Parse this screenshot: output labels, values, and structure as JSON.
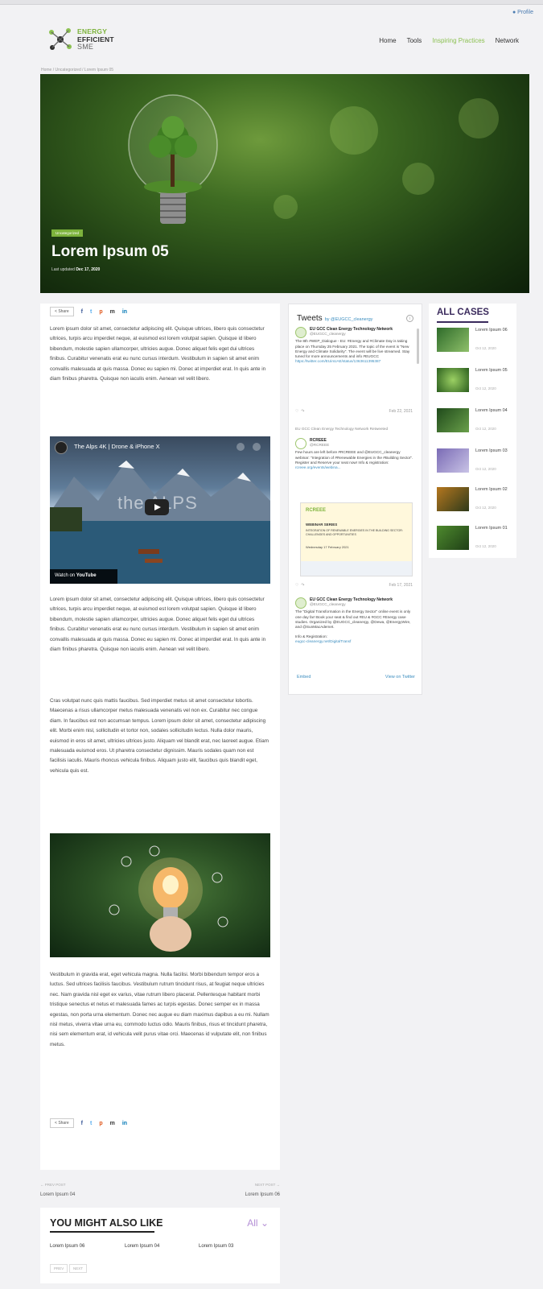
{
  "top": {
    "profile_label": "Profile"
  },
  "logo": {
    "line1": "ENERGY",
    "line2": "EFFICIENT",
    "line3": "SME"
  },
  "nav": {
    "items": [
      "Home",
      "Tools",
      "Inspiring Practices",
      "Network"
    ],
    "active": "Inspiring Practices"
  },
  "breadcrumb": "Home  /  Uncategorized  /  Lorem Ipsum 05",
  "hero": {
    "badge": "Uncategorized",
    "title": "Lorem Ipsum 05",
    "updated_label": "Last updated",
    "updated_date": "Dec 17, 2020"
  },
  "share": {
    "label": "Share",
    "icons": [
      "f",
      "t",
      "p",
      "m",
      "in"
    ]
  },
  "content": {
    "p1": "Lorem ipsum dolor sit amet, consectetur adipiscing elit. Quisque ultrices, libero quis consectetur ultrices, turpis arcu imperdiet neque, at euismod est lorem volutpat sapien. Quisque id libero bibendum, molestie sapien ullamcorper, ultricies augue. Donec aliquet felis eget dui ultrices finibus. Curabitur venenatis erat eu nunc cursus interdum. Vestibulum in sapien sit amet enim convallis malesuada at quis massa. Donec eu sapien mi. Donec at imperdiet erat. In quis ante in diam finibus pharetra. Quisque non iaculis enim. Aenean vel velit libero.",
    "video_title": "The Alps 4K | Drone & iPhone X",
    "video_watermark": "the ALPS",
    "video_watch": "Watch on",
    "video_brand": "YouTube",
    "p2": "Lorem ipsum dolor sit amet, consectetur adipiscing elit. Quisque ultrices, libero quis consectetur ultrices, turpis arcu imperdiet neque, at euismod est lorem volutpat sapien. Quisque id libero bibendum, molestie sapien ullamcorper, ultricies augue. Donec aliquet felis eget dui ultrices finibus. Curabitur venenatis erat eu nunc cursus interdum. Vestibulum in sapien sit amet enim convallis malesuada at quis massa. Donec eu sapien mi. Donec at imperdiet erat. In quis ante in diam finibus pharetra. Quisque non iaculis enim. Aenean vel velit libero.",
    "p3": "Cras volutpat nunc quis mattis faucibus. Sed imperdiet metus sit amet consectetur lobortis. Maecenas a risus ullamcorper metus malesuada venenatis vel non ex. Curabitur nec congue diam. In faucibus est non accumsan tempus. Lorem ipsum dolor sit amet, consectetur adipiscing elit. Morbi enim nisl, sollicitudin et tortor non, sodales sollicitudin lectus. Nulla dolor mauris, euismod in eros sit amet, ultricies ultrices justo. Aliquam vel blandit erat, nec laoreet augue. Etiam malesuada euismod eros. Ut pharetra consectetur dignissim. Mauris sodales quam non est facilisis iaculis. Mauris rhoncus vehicula finibus. Aliquam justo elit, faucibus quis blandit eget, vehicula quis est.",
    "p4": "Vestibulum in gravida erat, eget vehicula magna. Nulla facilisi. Morbi bibendum tempor eros a luctus. Sed ultrices facilisis faucibus. Vestibulum rutrum tincidunt risus, at feugiat neque ultricies nec. Nam gravida nisl eget ex varius, vitae rutrum libero placerat. Pellentesque habitant morbi tristique senectus et netus et malesuada fames ac turpis egestas. Donec semper ex in massa egestas, non porta urna elementum. Donec nec augue eu diam maximus dapibus a eu mi. Nullam nisl metus, viverra vitae urna eu, commodo luctus odio. Mauris finibus, risus et tincidunt pharetra, nisi sem elementum erat, id vehicula velit purus vitae orci. Maecenas id vulputate elit, non finibus metus."
  },
  "postnav": {
    "prev_label": "PREV POST",
    "prev_title": "Lorem Ipsum 04",
    "next_label": "NEXT POST",
    "next_title": "Lorem Ipsum 06"
  },
  "related": {
    "heading": "YOU MIGHT ALSO LIKE",
    "filter": "All",
    "items": [
      "Lorem Ipsum 06",
      "Lorem Ipsum 04",
      "Lorem Ipsum 03"
    ],
    "prev_btn": "PREV",
    "next_btn": "NEXT"
  },
  "tweets": {
    "title": "Tweets",
    "by": "by @EUGCC_cleanergy",
    "t1": {
      "name": "EU GCC Clean Energy Technology Network",
      "handle": "@EUGCC_cleanergy",
      "text": "The 8th #WEP_Dialogue - EU: #Energy and #Climate Day is taking place on Thursday 25 February 2021. The topic of the event is \"New Energy and Climate Solidarity\". The event will be live streamed. Stay tuned for more announcements and info #EUGCC",
      "link": "https://twitter.com/EUinUAE/status/1363611395387",
      "date": "Feb 22, 2021"
    },
    "retweet_label": "EU GCC Clean Energy Technology Network Retweeted",
    "t2": {
      "name": "RCREEE",
      "handle": "@RCREEE",
      "text": "Few hours are left before #RCREEE and @EUGCC_cleanergy webinar: \"Integration of #Renewable Energies in the #Building Sector\". Register and Reserve your seat now! Info & registration:",
      "link": "rcreee.org/events/webina...",
      "date": "Feb 17, 2021"
    },
    "embed": {
      "org": "RCREEE",
      "head": "WEBINAR SERIES",
      "sub": "INTEGRATION OF RENEWABLE ENERGIES IN THE BUILDING SECTOR: CHALLENGES AND OPPORTUNITIES",
      "date": "Wednesday 17 February 2021"
    },
    "t3": {
      "name": "EU GCC Clean Energy Technology Network",
      "handle": "@EUGCC_cleanergy",
      "text": "The \"Digital Transformation in the Energy Sector\" online event is only one day far! Book your seat & find out #EU & #GCC #Energy case studies. Organized by @EUGCC_cleanergy, @Dewa, @EnergyWire, and @SunMacAdemet.",
      "info": "Info & Registration:",
      "link": "eugcc-cleanergy.net/DigitalTransf"
    },
    "embed_label": "Embed",
    "view_label": "View on Twitter"
  },
  "cases": {
    "heading": "ALL CASES",
    "items": [
      {
        "title": "Lorem Ipsum 06",
        "date": "Oct 12, 2020"
      },
      {
        "title": "Lorem Ipsum 05",
        "date": "Oct 12, 2020"
      },
      {
        "title": "Lorem Ipsum 04",
        "date": "Oct 12, 2020"
      },
      {
        "title": "Lorem Ipsum 03",
        "date": "Oct 12, 2020"
      },
      {
        "title": "Lorem Ipsum 02",
        "date": "Oct 12, 2020"
      },
      {
        "title": "Lorem Ipsum 01",
        "date": "Oct 12, 2020"
      }
    ]
  },
  "colors": {
    "accent_green": "#8cc152",
    "cases_purple": "#3a2a5c",
    "link_blue": "#3b8dbf"
  }
}
